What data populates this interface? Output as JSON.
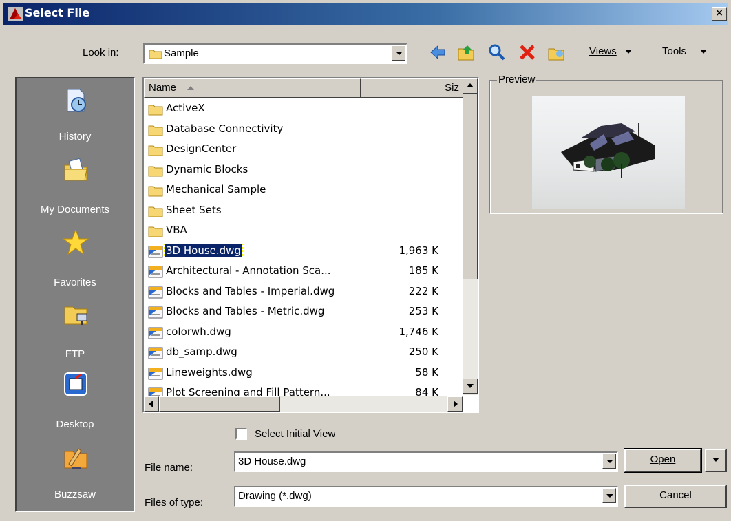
{
  "window": {
    "title": "Select File",
    "close_label": "×"
  },
  "lookin": {
    "label": "Look in:",
    "value": "Sample"
  },
  "toolbar": {
    "icons": [
      "back-icon",
      "up-folder-icon",
      "search-web-icon",
      "delete-icon",
      "create-folder-icon"
    ],
    "views_label": "Views",
    "tools_label": "Tools"
  },
  "places": [
    {
      "label": "History",
      "icon": "history-icon"
    },
    {
      "label": "My Documents",
      "icon": "my-documents-icon"
    },
    {
      "label": "Favorites",
      "icon": "favorites-star-icon"
    },
    {
      "label": "FTP",
      "icon": "ftp-icon"
    },
    {
      "label": "Desktop",
      "icon": "desktop-icon"
    },
    {
      "label": "Buzzsaw",
      "icon": "buzzsaw-icon"
    }
  ],
  "filelist": {
    "columns": {
      "name": "Name",
      "size": "Siz"
    },
    "rows": [
      {
        "name": "ActiveX",
        "size": "",
        "type": "folder"
      },
      {
        "name": "Database Connectivity",
        "size": "",
        "type": "folder"
      },
      {
        "name": "DesignCenter",
        "size": "",
        "type": "folder"
      },
      {
        "name": "Dynamic Blocks",
        "size": "",
        "type": "folder"
      },
      {
        "name": "Mechanical Sample",
        "size": "",
        "type": "folder"
      },
      {
        "name": "Sheet Sets",
        "size": "",
        "type": "folder"
      },
      {
        "name": "VBA",
        "size": "",
        "type": "folder"
      },
      {
        "name": "3D House.dwg",
        "size": "1,963 K",
        "type": "dwg",
        "selected": true
      },
      {
        "name": "Architectural - Annotation Sca...",
        "size": "185 K",
        "type": "dwg"
      },
      {
        "name": "Blocks and Tables - Imperial.dwg",
        "size": "222 K",
        "type": "dwg"
      },
      {
        "name": "Blocks and Tables - Metric.dwg",
        "size": "253 K",
        "type": "dwg"
      },
      {
        "name": "colorwh.dwg",
        "size": "1,746 K",
        "type": "dwg"
      },
      {
        "name": "db_samp.dwg",
        "size": "250 K",
        "type": "dwg"
      },
      {
        "name": "Lineweights.dwg",
        "size": "58 K",
        "type": "dwg"
      },
      {
        "name": "Plot Screening and Fill Pattern...",
        "size": "84 K",
        "type": "dwg"
      }
    ]
  },
  "preview": {
    "label": "Preview"
  },
  "select_initial_view": {
    "label": "Select Initial View",
    "checked": false
  },
  "filename": {
    "label": "File name:",
    "value": "3D House.dwg"
  },
  "filetype": {
    "label": "Files of type:",
    "value": "Drawing (*.dwg)"
  },
  "buttons": {
    "open": "Open",
    "cancel": "Cancel"
  },
  "colors": {
    "titlebar_start": "#0a246a",
    "titlebar_end": "#a6caf0",
    "dialog_bg": "#d4d0c8",
    "selection": "#0a246a",
    "places_bg": "#808080"
  }
}
